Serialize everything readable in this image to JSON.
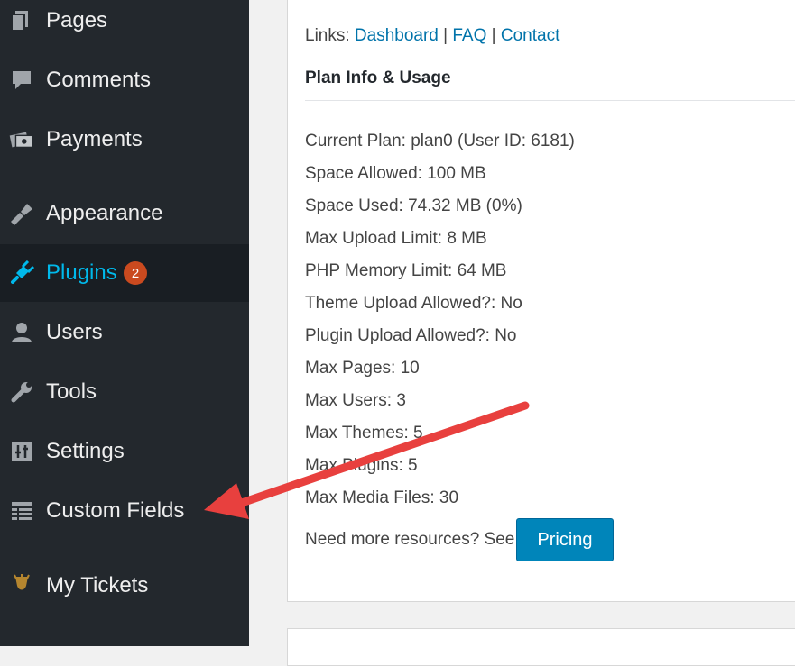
{
  "sidebar": {
    "items": [
      {
        "label": "Pages",
        "icon": "pages-icon"
      },
      {
        "label": "Comments",
        "icon": "comments-icon"
      },
      {
        "label": "Payments",
        "icon": "payments-icon"
      },
      {
        "label": "Appearance",
        "icon": "appearance-icon"
      },
      {
        "label": "Plugins",
        "icon": "plugins-icon",
        "badge": "2",
        "active": true
      },
      {
        "label": "Users",
        "icon": "users-icon"
      },
      {
        "label": "Tools",
        "icon": "tools-icon"
      },
      {
        "label": "Settings",
        "icon": "settings-icon"
      },
      {
        "label": "Custom Fields",
        "icon": "custom-fields-icon"
      },
      {
        "label": "My Tickets",
        "icon": "tickets-icon"
      }
    ]
  },
  "main": {
    "links_prefix": "Links:",
    "links": [
      "Dashboard",
      "FAQ",
      "Contact"
    ],
    "link_separator": "|",
    "section_title": "Plan Info & Usage",
    "info_lines": [
      "Current Plan: plan0 (User ID: 6181)",
      "Space Allowed: 100 MB",
      "Space Used: 74.32 MB (0%)",
      "Max Upload Limit: 8 MB",
      "PHP Memory Limit: 64 MB",
      "Theme Upload Allowed?: No",
      "Plugin Upload Allowed?: No",
      "Max Pages: 10",
      "Max Users: 3",
      "Max Themes: 5",
      "Max Plugins: 5",
      "Max Media Files: 30"
    ],
    "need_more_text": "Need more resources? See",
    "pricing_label": "Pricing"
  },
  "colors": {
    "sidebar_bg": "#23282d",
    "active_text": "#00b9eb",
    "badge_bg": "#ca4a1f",
    "link": "#0073aa",
    "button": "#0085ba",
    "arrow": "#e8403e"
  }
}
